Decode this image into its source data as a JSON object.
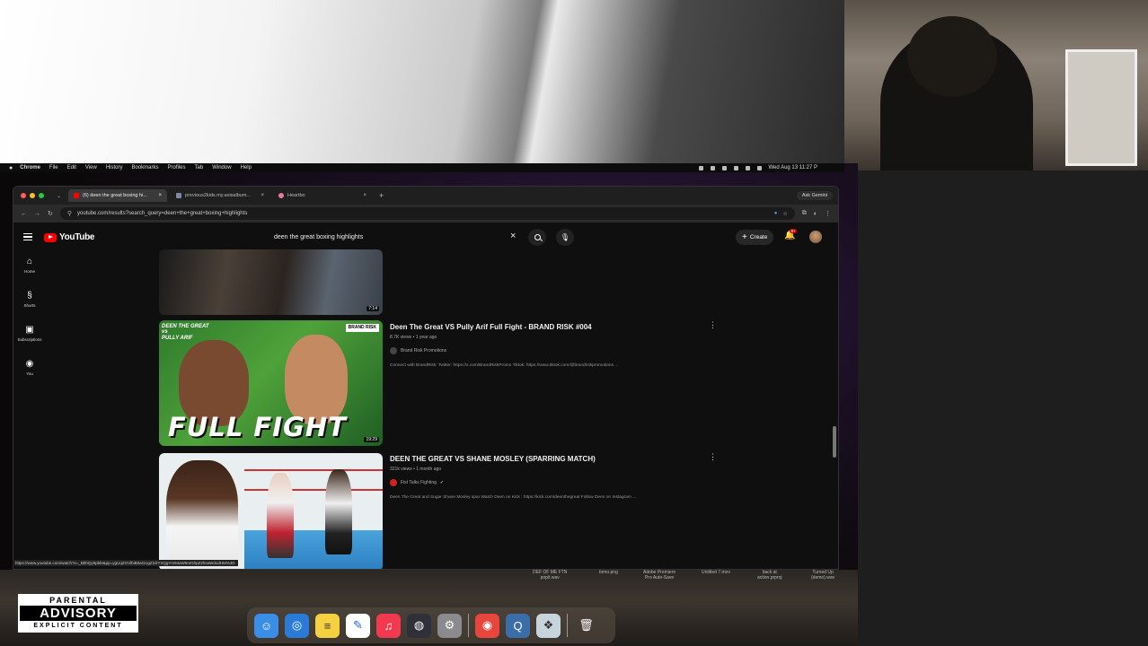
{
  "menubar": {
    "apple": "",
    "items": [
      "Chrome",
      "File",
      "Edit",
      "View",
      "History",
      "Bookmarks",
      "Profiles",
      "Tab",
      "Window",
      "Help"
    ],
    "clock": "Wed Aug 13  11:27 P"
  },
  "chrome": {
    "tabs": [
      {
        "label": "(6) deen the great boxing hi...",
        "active": true,
        "favicon_color": "#ff0000"
      },
      {
        "label": "previous2kids.my.axisalbum..."
      },
      {
        "label": "Heartbo"
      }
    ],
    "new_tab": "+",
    "ask_gemini": "Ask Gemini",
    "url": "youtube.com/results?search_query=deen+the+great+boxing+highlights",
    "status_url": "https://www.youtube.com/watch?v=_BbhQy9pbkI&pp=ygUqZGVlbiB0aGUgZ3JlYXQgYm94aW5nIGhpZ2hsaWdodHM%3D"
  },
  "youtube": {
    "logo": "YouTube",
    "search_query": "deen the great boxing highlights",
    "create_label": "Create",
    "notification_count": "9+",
    "sidebar": [
      {
        "label": "Home",
        "icon": "home-icon",
        "glyph": "⌂"
      },
      {
        "label": "Shorts",
        "icon": "shorts-icon",
        "glyph": "§"
      },
      {
        "label": "Subscriptions",
        "icon": "subscriptions-icon",
        "glyph": "▣"
      },
      {
        "label": "You",
        "icon": "you-icon",
        "glyph": "◉"
      }
    ],
    "results": [
      {
        "duration": "7:14"
      },
      {
        "title": "Deen The Great VS Pully Arif Full Fight - BRAND RISK #004",
        "meta": "8.7K views • 1 year ago",
        "channel": "Brand Risk Promotions",
        "channel_color": "#444444",
        "description": "Connect with BrandRisk: Twitter: https://x.com/BrandRiskPromo Tiktok: https://www.tiktok.com/@brandriskpromotions ...",
        "duration": "19:29",
        "thumb_tag_left": "DEEN THE GREAT\nvs\nPULLY ARIF",
        "thumb_tag_right": "BRAND RISK",
        "thumb_text": "FULL FIGHT"
      },
      {
        "title": "DEEN THE GREAT VS SHANE MOSLEY (SPARRING MATCH)",
        "meta": "321k views • 1 month ago",
        "channel": "Fist Talks Fighting",
        "channel_color": "#d42020",
        "verified": "✔",
        "description": "Deen The Great and Sugar Shane Mosley spar Watch Deen on Kick : https://kick.com/deenthegreat Follow Deen on Instagram ..."
      }
    ]
  },
  "desktop_files": [
    "DEF OF ME FTN\npopit.wav",
    "tomo.png",
    "Adobe Premiere\nPro Auto-Save",
    "Untitled 7.mov",
    "back at\naction.prproj",
    "Turned Up\n(demo).wav"
  ],
  "advisory": {
    "line1": "PARENTAL",
    "line2": "ADVISORY",
    "line3": "EXPLICIT CONTENT"
  },
  "dock": [
    {
      "name": "finder-icon",
      "glyph": "☺",
      "color": "#3a8ee6"
    },
    {
      "name": "safari-icon",
      "glyph": "◎",
      "color": "#2a7bd8"
    },
    {
      "name": "notes-icon",
      "glyph": "≡",
      "color": "#f5d142"
    },
    {
      "name": "freeform-icon",
      "glyph": "✎",
      "color": "#ffffff"
    },
    {
      "name": "music-icon",
      "glyph": "♫",
      "color": "#f3394f"
    },
    {
      "name": "obs-icon",
      "glyph": "◍",
      "color": "#30303a"
    },
    {
      "name": "settings-icon",
      "glyph": "⚙",
      "color": "#8a8a8f"
    },
    {
      "name": "chrome-icon",
      "glyph": "◉",
      "color": "#e8453c"
    },
    {
      "name": "quicktime-icon",
      "glyph": "Q",
      "color": "#3b6ea8"
    },
    {
      "name": "screen-recorder-icon",
      "glyph": "❖",
      "color": "#c8d4dc"
    },
    {
      "name": "trash-icon",
      "glyph": "🗑",
      "color": "#9a9a9a"
    }
  ]
}
